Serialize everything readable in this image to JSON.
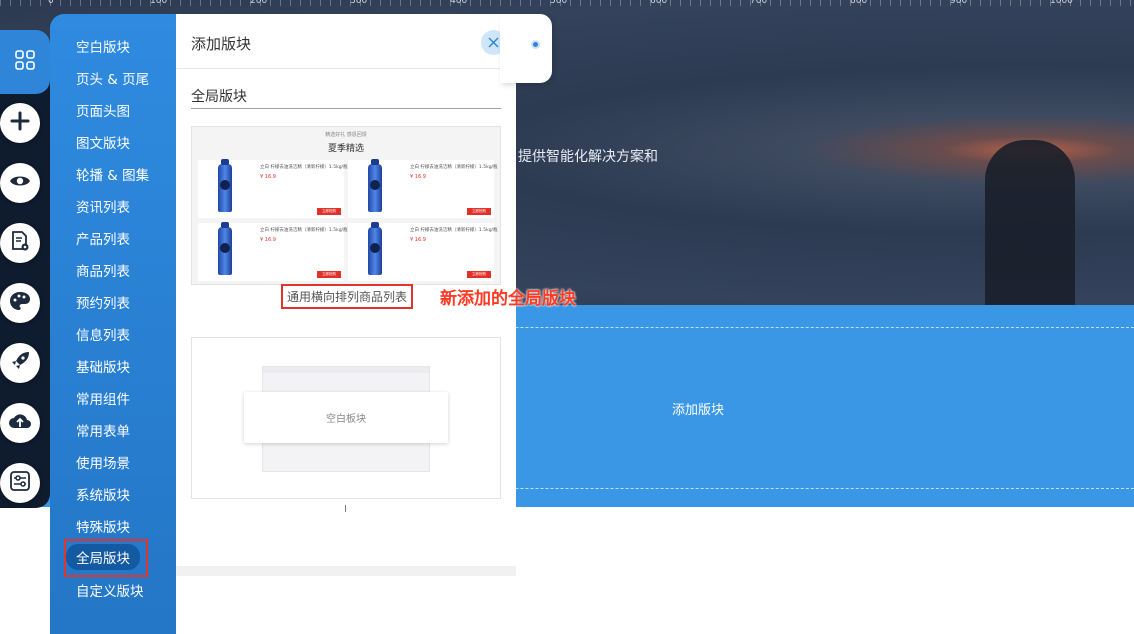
{
  "canvas": {
    "hero_text": "提供智能化解决方案和",
    "add_block_label": "添加版块",
    "ruler_numbers": [
      "0",
      "100",
      "200",
      "300",
      "400",
      "500",
      "600",
      "700",
      "800",
      "900",
      "1000"
    ]
  },
  "dock": {
    "icons": [
      "grid-icon",
      "plus-icon",
      "eye-icon",
      "page-settings-icon",
      "palette-icon",
      "rocket-icon",
      "cloud-upload-icon",
      "sliders-icon"
    ]
  },
  "categories": {
    "items": [
      "空白版块",
      "页头 & 页尾",
      "页面头图",
      "图文版块",
      "轮播 & 图集",
      "资讯列表",
      "产品列表",
      "商品列表",
      "预约列表",
      "信息列表",
      "基础版块",
      "常用组件",
      "常用表单",
      "使用场景",
      "系统版块",
      "特殊版块",
      "全局版块",
      "自定义版块"
    ],
    "active_index": 16
  },
  "panel": {
    "title": "添加版块",
    "section_title": "全局版块",
    "card1": {
      "mini_top": "精选好礼 感恩回馈",
      "mini_title": "夏季精选",
      "product_name": "立白 柠檬去油洗洁精（清新柠檬）1.5kg/瓶",
      "product_price": "¥ 16.9",
      "buy_label": "立即抢购",
      "label": "通用横向排列商品列表"
    },
    "card2": {
      "label": "空白板块"
    },
    "cursor": "I"
  },
  "annotation": "新添加的全局版块",
  "colors": {
    "accent": "#2f86d8",
    "highlight": "#e0342c",
    "band": "#3a97e5"
  }
}
